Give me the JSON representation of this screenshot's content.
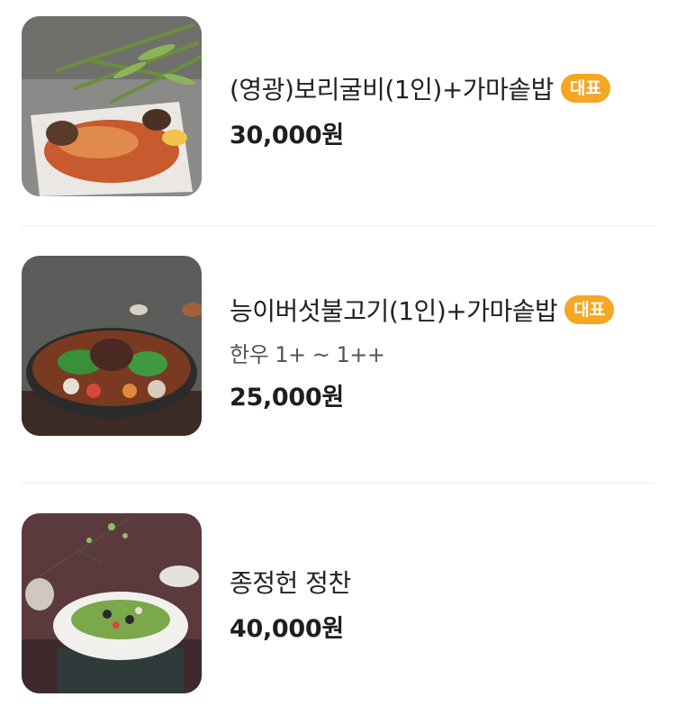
{
  "menu": {
    "items": [
      {
        "name": "(영광)보리굴비(1인)+가마솥밥",
        "badge": "대표",
        "price": "30,000원"
      },
      {
        "name": "능이버섯불고기(1인)+가마솥밥",
        "badge": "대표",
        "description": "한우 1+ ~ 1++",
        "price": "25,000원"
      },
      {
        "name": "종정헌 정찬",
        "price": "40,000원"
      }
    ]
  },
  "colors": {
    "badge": "#f5a623",
    "divider": "#ececec",
    "price": "#1e1e1e"
  },
  "images": [
    "grilled-croaker-photo",
    "mushroom-bulgogi-hotpot-photo",
    "salad-course-photo"
  ]
}
